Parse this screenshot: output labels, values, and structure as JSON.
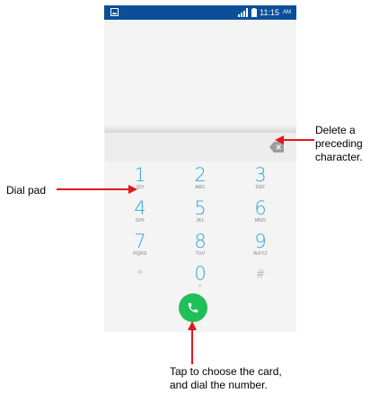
{
  "status_bar": {
    "time": "11:15",
    "ampm": "AM"
  },
  "keypad": [
    {
      "digit": "1",
      "letters": "QO"
    },
    {
      "digit": "2",
      "letters": "ABC"
    },
    {
      "digit": "3",
      "letters": "DEF"
    },
    {
      "digit": "4",
      "letters": "GHI"
    },
    {
      "digit": "5",
      "letters": "JKL"
    },
    {
      "digit": "6",
      "letters": "MNO"
    },
    {
      "digit": "7",
      "letters": "PQRS"
    },
    {
      "digit": "8",
      "letters": "TUV"
    },
    {
      "digit": "9",
      "letters": "WXYZ"
    },
    {
      "digit": "*",
      "letters": ""
    },
    {
      "digit": "0",
      "letters": "+"
    },
    {
      "digit": "#",
      "letters": ""
    }
  ],
  "annotations": {
    "delete": [
      "Delete a",
      "preceding",
      "character."
    ],
    "dialpad": "Dial pad",
    "call": [
      "Tap to choose the card,",
      "and dial the number."
    ]
  },
  "colors": {
    "accent": "#2fa8d8",
    "call_button": "#1fbf5a",
    "status_bar": "#0b4f98",
    "arrow": "#e01818"
  }
}
